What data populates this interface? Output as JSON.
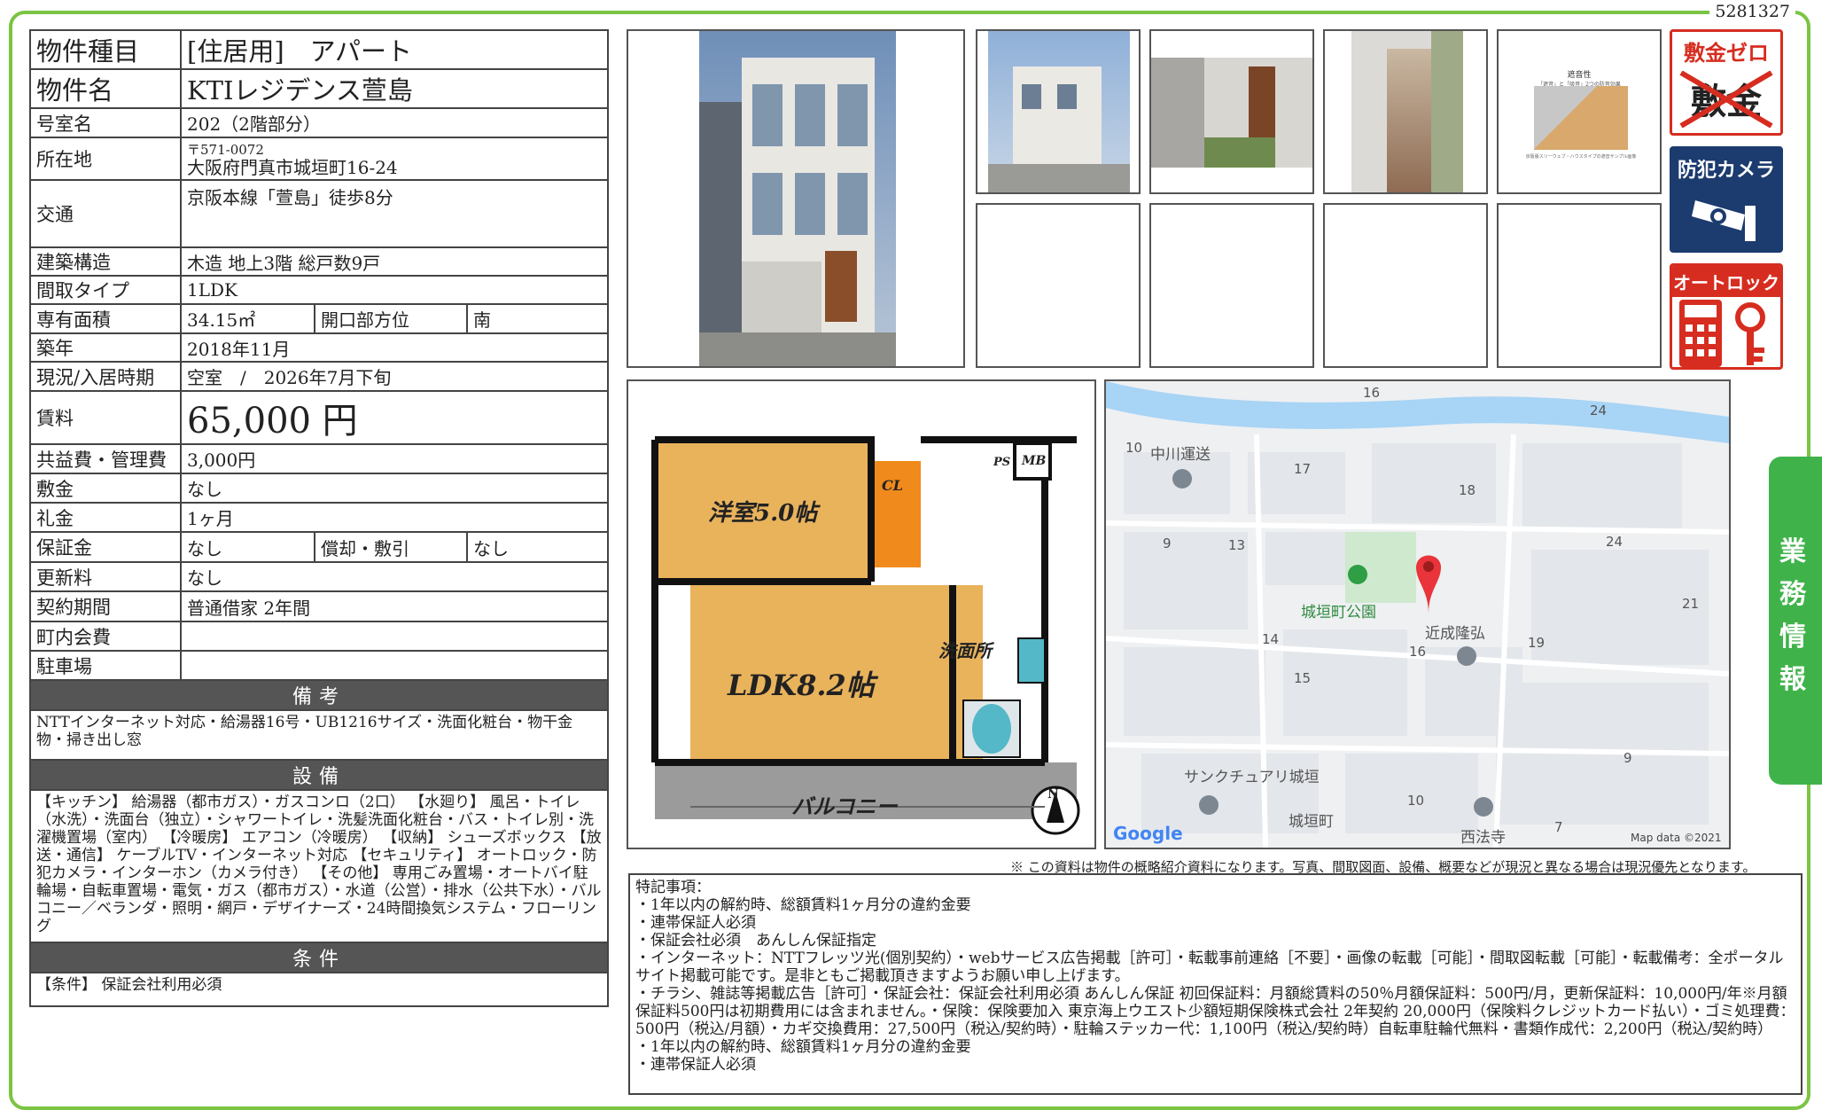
{
  "doc_id": "5281327",
  "property": {
    "type_label": "物件種目",
    "type_value": "[住居用]　アパート",
    "name_label": "物件名",
    "name_value": "KTIレジデンス萱島",
    "room_label": "号室名",
    "room_value": "202（2階部分）",
    "address_label": "所在地",
    "postal": "〒571-0072",
    "address": "大阪府門真市城垣町16-24",
    "transport_label": "交通",
    "transport_value": "京阪本線「萱島」徒歩8分",
    "structure_label": "建築構造",
    "structure_value": "木造 地上3階 総戸数9戸",
    "layout_label": "間取タイプ",
    "layout_value": "1LDK",
    "area_label": "専有面積",
    "area_value": "34.15㎡",
    "direction_label": "開口部方位",
    "direction_value": "南",
    "built_label": "築年",
    "built_value": "2018年11月",
    "status_label": "現況/入居時期",
    "status_value": "空室　/　2026年7月下旬",
    "rent_label": "賃料",
    "rent_value": "65,000 円",
    "fee_label": "共益費・管理費",
    "fee_value": "3,000円",
    "deposit_label": "敷金",
    "deposit_value": "なし",
    "keymoney_label": "礼金",
    "keymoney_value": "1ヶ月",
    "security_label": "保証金",
    "security_value": "なし",
    "amort_label": "償却・敷引",
    "amort_value": "なし",
    "renewal_label": "更新料",
    "renewal_value": "なし",
    "contract_label": "契約期間",
    "contract_value": "普通借家 2年間",
    "town_label": "町内会費",
    "town_value": "",
    "parking_label": "駐車場",
    "parking_value": ""
  },
  "remarks_header": "備考",
  "remarks_text": "NTTインターネット対応・給湯器16号・UB1216サイズ・洗面化粧台・物干金物・掃き出し窓",
  "equipment_header": "設備",
  "equipment_text": "【キッチン】 給湯器（都市ガス）・ガスコンロ（2口） 【水廻り】 風呂・トイレ（水洗）・洗面台（独立）・シャワートイレ・洗髪洗面化粧台・バス・トイレ別・洗濯機置場（室内） 【冷暖房】 エアコン（冷暖房） 【収納】 シューズボックス 【放送・通信】 ケーブルTV・インターネット対応 【セキュリティ】 オートロック・防犯カメラ・インターホン（カメラ付き） 【その他】 専用ごみ置場・オートバイ駐輪場・自転車置場・電気・ガス（都市ガス）・水道（公営）・排水（公共下水）・バルコニー／ベランダ・照明・網戸・デザイナーズ・24時間換気システム・フローリング",
  "conditions_header": "条件",
  "conditions_text": "【条件】 保証会社利用必須",
  "badges": {
    "zero": "敷金ゼロ",
    "zero_crossed": "敷金",
    "camera": "防犯カメラ",
    "autolock": "オートロック"
  },
  "photo_doc": {
    "title": "遮音性",
    "sub": "「遮音」と「吸音」2つの防音効果",
    "caption": "京阪版スリーウェブ・ハウスタイプの遮音サンプル画像"
  },
  "floorplan": {
    "room1": "洋室5.0帖",
    "ldk": "LDK8.2帖",
    "cl": "CL",
    "ps": "PS",
    "mb": "MB",
    "washroom": "洗面所",
    "balcony": "バルコニー",
    "north": "N"
  },
  "map": {
    "numbers": [
      "16",
      "24",
      "10",
      "17",
      "18",
      "9",
      "13",
      "24",
      "21",
      "14",
      "16",
      "19",
      "15",
      "9",
      "10",
      "7"
    ],
    "poi_nakagawa": "中川運送",
    "poi_park": "城垣町公園",
    "poi_kinsei": "近成隆弘",
    "poi_sanctuary": "サンクチュアリ城垣",
    "poi_town": "城垣町",
    "poi_temple": "西法寺",
    "google": "Google",
    "attribution": "Map data ©2021"
  },
  "disclaimer": "※ この資料は物件の概略紹介資料になります。写真、間取図面、設備、概要などが現況と異なる場合は現況優先となります。",
  "special_notes": [
    "特記事項：",
    "・1年以内の解約時、総額賃料1ヶ月分の違約金要",
    "・連帯保証人必須",
    "・保証会社必須　あんしん保証指定",
    "・インターネット：NTTフレッツ光(個別契約）・webサービス広告掲載［許可］・転載事前連絡［不要］・画像の転載［可能］・間取図転載［可能］・転載備考：全ポータルサイト掲載可能です。是非ともご掲載頂きますようお願い申し上げます。",
    "・チラシ、雑誌等掲載広告［許可］・保証会社：保証会社利用必須 あんしん保証 初回保証料：月額総賃料の50％月額保証料：500円/月，更新保証料：10,000円/年※月額保証料500円は初期費用には含まれません。・保険：保険要加入 東京海上ウエスト少額短期保険株式会社 2年契約 20,000円（保険料クレジットカード払い）・ゴミ処理費：500円（税込/月額）・カギ交換費用：27,500円（税込/契約時）・駐輪ステッカー代：1,100円（税込/契約時）自転車駐輪代無料・書類作成代：2,200円（税込/契約時）",
    "・1年以内の解約時、総額賃料1ヶ月分の違約金要",
    "・連帯保証人必須"
  ],
  "sidetab": [
    "業",
    "務",
    "情",
    "報"
  ],
  "colors": {
    "frame": "#7cc444",
    "header_bar": "#555555",
    "badge_red": "#d62d20",
    "badge_navy": "#1c3b6e",
    "tab_green": "#3fb34a"
  }
}
